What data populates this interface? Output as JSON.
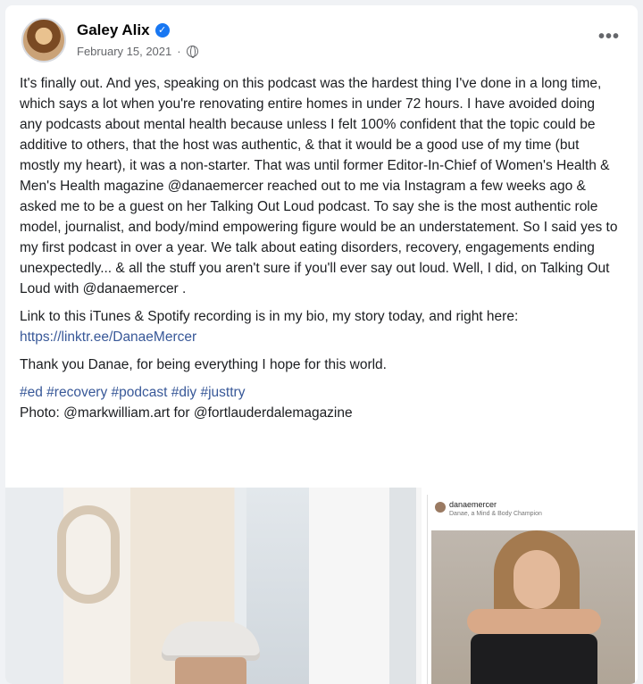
{
  "post": {
    "author": "Galey Alix",
    "verified_icon": "✓",
    "date": "February 15, 2021",
    "date_separator": "·",
    "more_label": "•••",
    "paragraphs": [
      "It's finally out. And yes, speaking on this podcast was the hardest thing I've done in a long time, which says a lot when you're renovating entire homes in under 72 hours. I have avoided doing any podcasts about mental health because unless I felt 100% confident that the topic could be additive to others, that the host was authentic, & that it would be a good use of my time (but mostly my heart), it was a non-starter. That was until former Editor-In-Chief of Women's Health & Men's Health magazine @danaemercer reached out to me via Instagram a few weeks ago & asked me to be a guest on her Talking Out Loud podcast. To say she is the most authentic role model, journalist, and body/mind empowering figure would be an understatement. So I said yes to my first podcast in over a year. We talk about eating disorders, recovery, engagements ending unexpectedly... & all the stuff you aren't sure if you'll ever say out loud. Well, I did, on Talking Out Loud with @danaemercer .",
      "Link to this iTunes & Spotify recording is in my bio, my story today, and right here:",
      "Thank you Danae, for being everything I hope for this world."
    ],
    "link": "https://linktr.ee/DanaeMercer",
    "hashtags": "#ed #recovery #podcast #diy #justtry",
    "photo_credit": "Photo: @markwilliam.art for @fortlauderdalemagazine"
  },
  "embedded_post": {
    "username": "danaemercer",
    "subtitle": "Danae, a Mind & Body Champion"
  }
}
